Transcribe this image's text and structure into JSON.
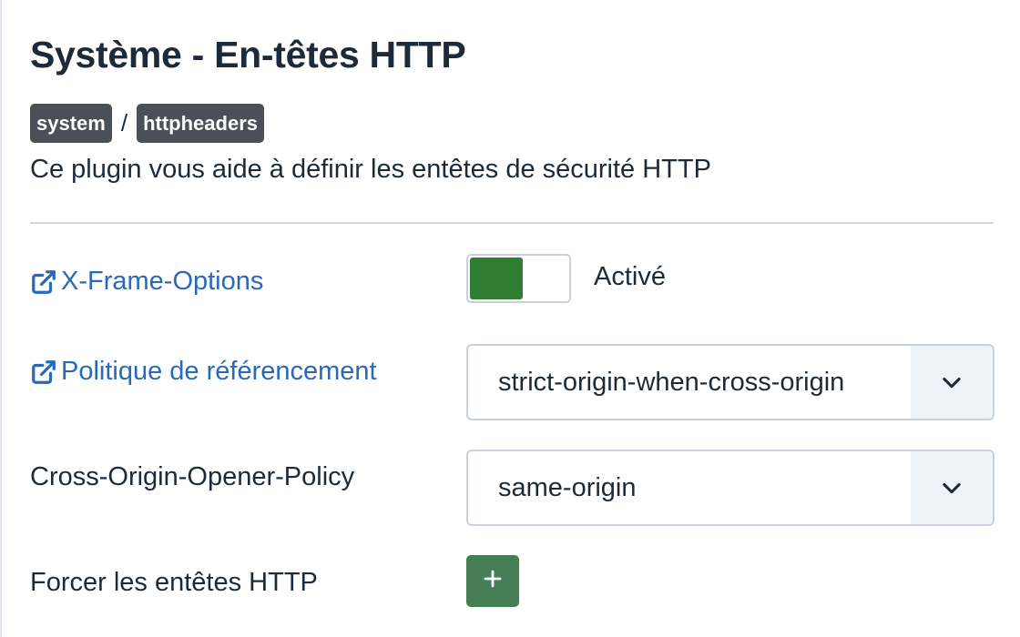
{
  "header": {
    "title": "Système - En-têtes HTTP",
    "breadcrumb": {
      "group": "system",
      "separator": "/",
      "element": "httpheaders"
    },
    "description": "Ce plugin vous aide à définir les entêtes de sécurité HTTP"
  },
  "fields": {
    "x_frame_options": {
      "label": "X-Frame-Options",
      "icon": "external-link-icon",
      "toggle_on": true,
      "status": "Activé"
    },
    "referrer_policy": {
      "label": "Politique de référencement",
      "icon": "external-link-icon",
      "value": "strict-origin-when-cross-origin"
    },
    "coop": {
      "label": "Cross-Origin-Opener-Policy",
      "value": "same-origin"
    },
    "force_headers": {
      "label": "Forcer les entêtes HTTP",
      "button_symbol": "+"
    }
  },
  "colors": {
    "link": "#2a69b8",
    "toggle_on": "#2e7d32",
    "add_button": "#457d54",
    "tag_bg": "#495057"
  }
}
